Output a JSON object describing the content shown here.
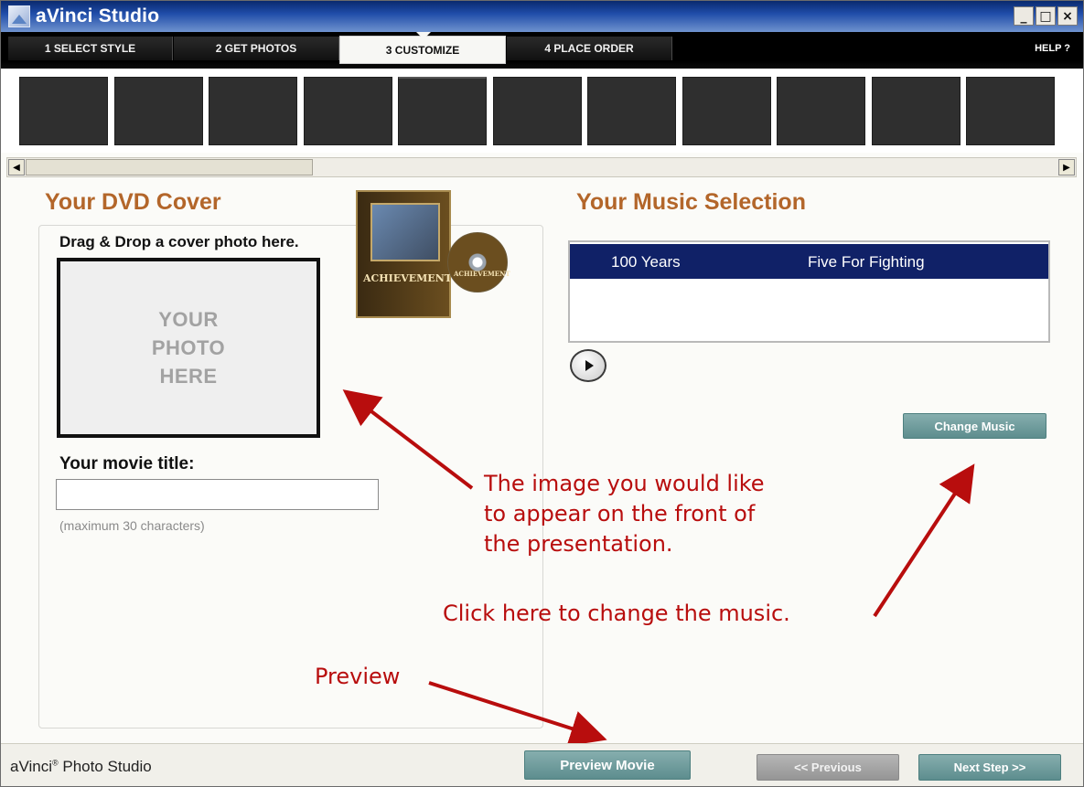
{
  "window": {
    "title": "aVinci Studio",
    "controls": {
      "minimize": "_",
      "maximize": "□",
      "close": "×"
    }
  },
  "tabs": [
    {
      "label": "1 SELECT STYLE",
      "active": false
    },
    {
      "label": "2 GET PHOTOS",
      "active": false
    },
    {
      "label": "3 CUSTOMIZE",
      "active": true
    },
    {
      "label": "4 PLACE ORDER",
      "active": false
    }
  ],
  "help_label": "HELP ?",
  "thumbnail_count": 11,
  "scrollbar": {
    "left_arrow": "◀",
    "right_arrow": "▶"
  },
  "cover": {
    "heading": "Your DVD Cover",
    "drag_label": "Drag & Drop a cover photo here.",
    "placeholder_lines": [
      "YOUR",
      "PHOTO",
      "HERE"
    ],
    "title_label": "Your movie title:",
    "title_value": "",
    "title_hint": "(maximum 30 characters)",
    "sample_case_label": "ACHIEVEMENT",
    "sample_disc_label": "ACHIEVEMENT"
  },
  "music": {
    "heading": "Your Music Selection",
    "selected": {
      "song": "100 Years",
      "artist": "Five For Fighting"
    },
    "change_button": "Change Music"
  },
  "annotations": {
    "image_note": [
      "The image you would like",
      "to appear on the front of",
      "the presentation."
    ],
    "music_note": "Click here to change the music.",
    "preview_note": "Preview"
  },
  "footer": {
    "brand": "aVinci",
    "brand_mark": "®",
    "brand_suffix": " Photo Studio",
    "preview_button": "Preview Movie",
    "previous_button": "<< Previous",
    "next_button": "Next Step >>"
  },
  "colors": {
    "heading": "#b3662a",
    "annotation": "#b80d0d",
    "selection": "#102167",
    "button_teal": "#6f9b9c"
  }
}
